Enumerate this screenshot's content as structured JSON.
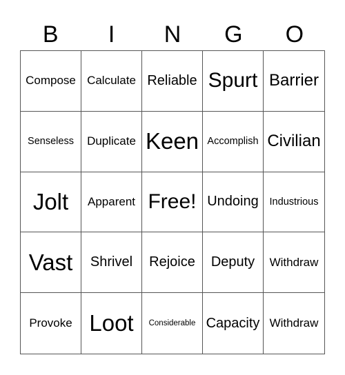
{
  "header": {
    "letters": [
      "B",
      "I",
      "N",
      "G",
      "O"
    ]
  },
  "board": {
    "rows": [
      [
        "Compose",
        "Calculate",
        "Reliable",
        "Spurt",
        "Barrier"
      ],
      [
        "Senseless",
        "Duplicate",
        "Keen",
        "Accomplish",
        "Civilian"
      ],
      [
        "Jolt",
        "Apparent",
        "Free!",
        "Undoing",
        "Industrious"
      ],
      [
        "Vast",
        "Shrivel",
        "Rejoice",
        "Deputy",
        "Withdraw"
      ],
      [
        "Provoke",
        "Loot",
        "Considerable",
        "Capacity",
        "Withdraw"
      ]
    ],
    "free_space": "Free!"
  }
}
